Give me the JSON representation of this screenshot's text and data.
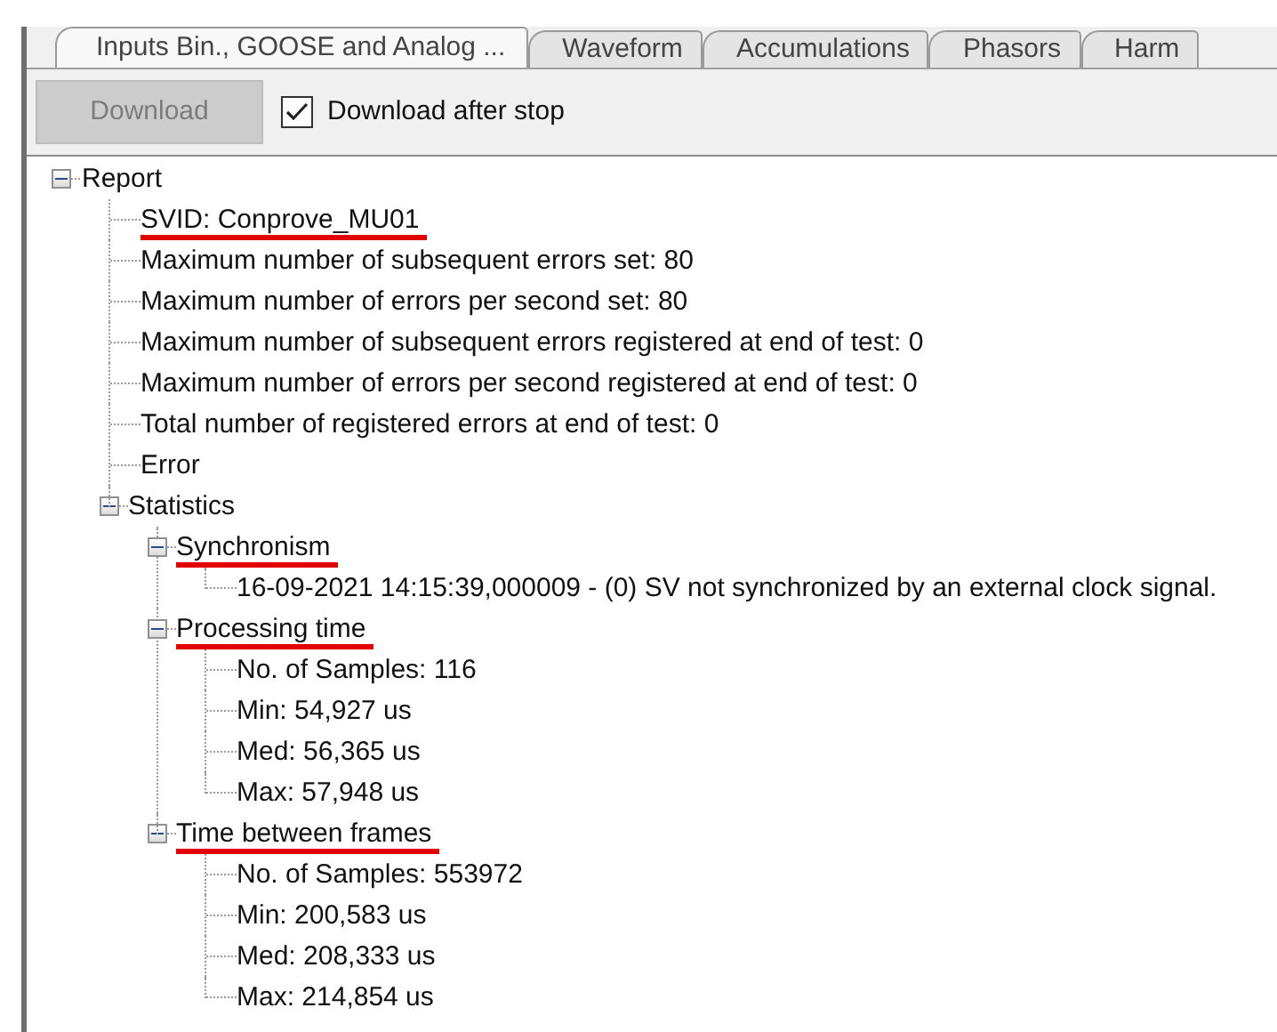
{
  "tabs": [
    {
      "label": "Inputs Bin., GOOSE and Analog ...",
      "selected": true
    },
    {
      "label": "Waveform",
      "selected": false
    },
    {
      "label": "Accumulations",
      "selected": false
    },
    {
      "label": "Phasors",
      "selected": false
    },
    {
      "label": "Harm",
      "selected": false
    }
  ],
  "toolbar": {
    "download_button": {
      "label": "Download",
      "disabled": true
    },
    "download_after_stop": {
      "label": "Download after stop",
      "checked": true
    }
  },
  "tree": [
    {
      "label": "Report",
      "underlined": false,
      "expanded": true,
      "children": [
        {
          "label": "SVID: Conprove_MU01",
          "underlined": true
        },
        {
          "label": "Maximum number of subsequent errors set: 80",
          "underlined": false
        },
        {
          "label": "Maximum number of errors per second set: 80",
          "underlined": false
        },
        {
          "label": "Maximum number of subsequent errors registered at end of test: 0",
          "underlined": false
        },
        {
          "label": "Maximum number of errors per second registered at end of test: 0",
          "underlined": false
        },
        {
          "label": "Total number of registered errors at end of test: 0",
          "underlined": false
        },
        {
          "label": "Error",
          "underlined": false
        },
        {
          "label": "Statistics",
          "underlined": false,
          "expanded": true,
          "children": [
            {
              "label": "Synchronism",
              "underlined": true,
              "expanded": true,
              "children": [
                {
                  "label": "16-09-2021 14:15:39,000009 - (0) SV not synchronized by an external clock signal.",
                  "underlined": false
                }
              ]
            },
            {
              "label": "Processing time",
              "underlined": true,
              "expanded": true,
              "children": [
                {
                  "label": "No. of Samples: 116",
                  "underlined": false
                },
                {
                  "label": "Min: 54,927 us",
                  "underlined": false
                },
                {
                  "label": "Med: 56,365 us",
                  "underlined": false
                },
                {
                  "label": "Max: 57,948 us",
                  "underlined": false
                }
              ]
            },
            {
              "label": "Time between frames",
              "underlined": true,
              "expanded": true,
              "children": [
                {
                  "label": "No. of Samples: 553972",
                  "underlined": false
                },
                {
                  "label": "Min: 200,583 us",
                  "underlined": false
                },
                {
                  "label": "Med: 208,333 us",
                  "underlined": false
                },
                {
                  "label": "Max: 214,854 us",
                  "underlined": false
                }
              ]
            }
          ]
        }
      ]
    }
  ]
}
